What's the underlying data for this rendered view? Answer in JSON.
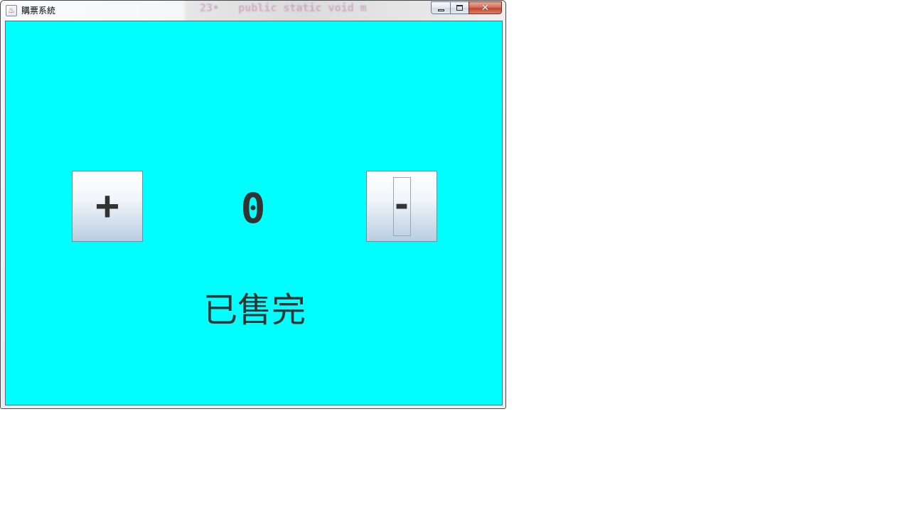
{
  "window": {
    "title": "購票系統",
    "icon": "java-cup-icon",
    "background_ghost_text": "23•   public static void m"
  },
  "caption_buttons": {
    "minimize": "minimize-icon",
    "maximize": "maximize-icon",
    "close": "close-icon",
    "close_glyph": "✕"
  },
  "panel": {
    "background_color": "#00ffff",
    "increment_label": "+",
    "count_value": "0",
    "decrement_label": "-",
    "status_text": "已售完"
  },
  "colors": {
    "text": "#333333",
    "close_button": "#c2432c"
  }
}
